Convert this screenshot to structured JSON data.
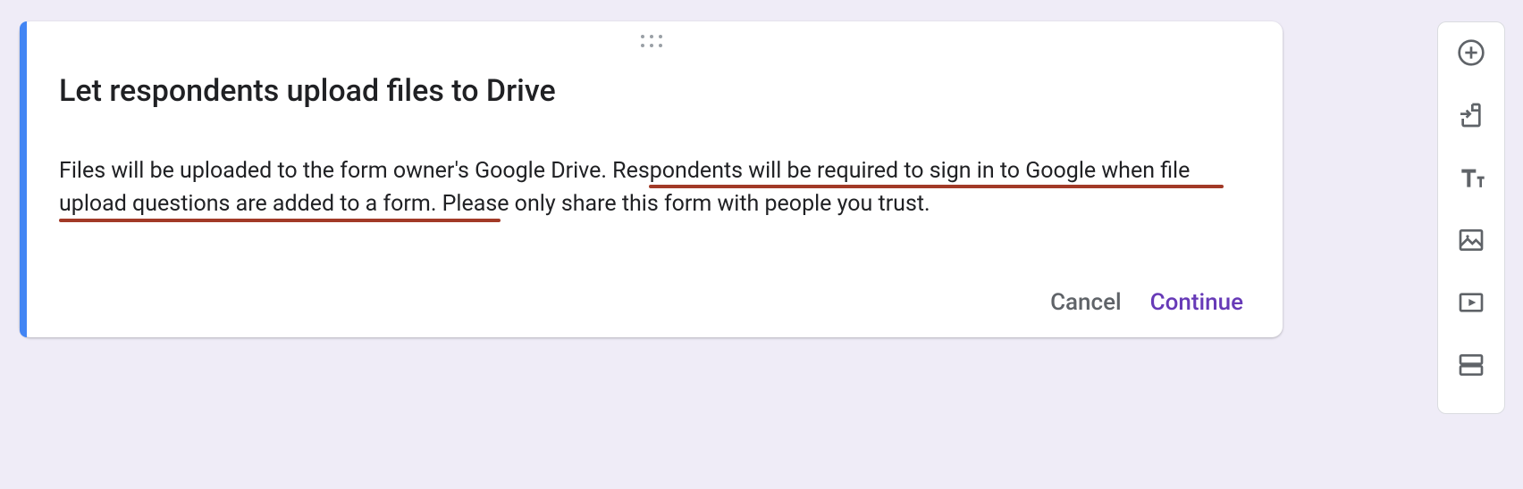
{
  "card": {
    "title": "Let respondents upload files to Drive",
    "body": "Files will be uploaded to the form owner's Google Drive. Respondents will be required to sign in to Google when file upload questions are added to a form. Please only share this form with people you trust.",
    "actions": {
      "cancel": "Cancel",
      "continue": "Continue"
    }
  },
  "toolbar": {
    "items": [
      {
        "name": "add-question",
        "icon": "plus-circle"
      },
      {
        "name": "import-questions",
        "icon": "file-import"
      },
      {
        "name": "add-title",
        "icon": "text"
      },
      {
        "name": "add-image",
        "icon": "image"
      },
      {
        "name": "add-video",
        "icon": "video"
      },
      {
        "name": "add-section",
        "icon": "section"
      }
    ]
  },
  "annotation_color": "#A23A27",
  "accent_color": "#4285F4",
  "primary_action_color": "#673AB7"
}
